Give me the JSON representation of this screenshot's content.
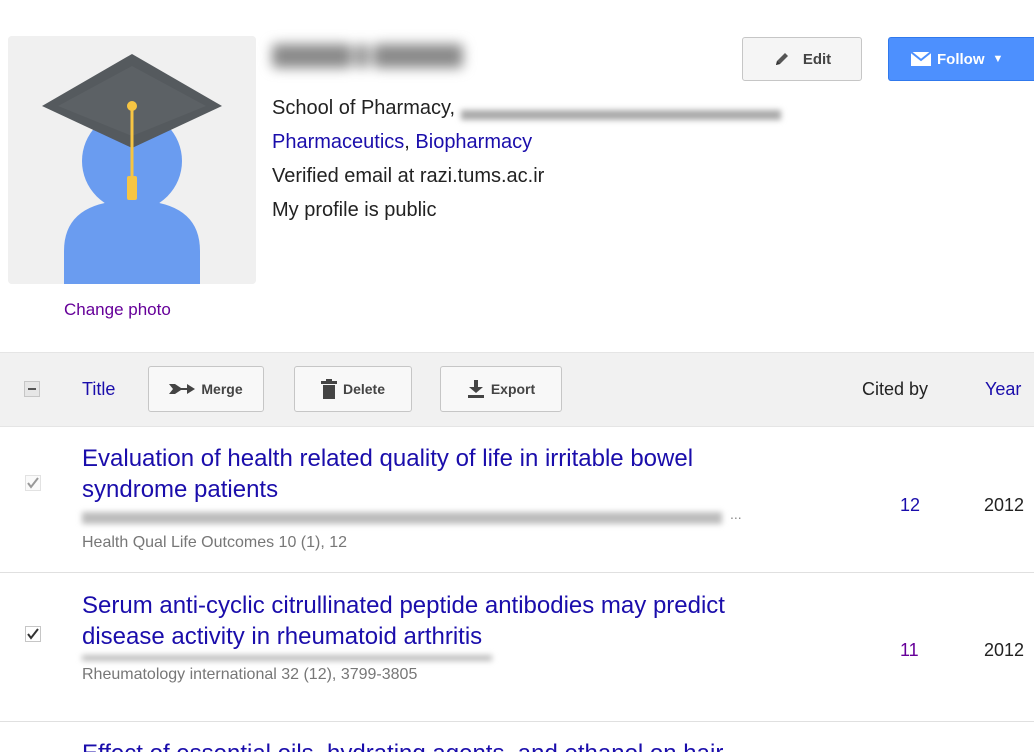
{
  "profile": {
    "change_photo": "Change photo",
    "affiliation": "School of Pharmacy,",
    "interests": [
      "Pharmaceutics",
      "Biopharmacy"
    ],
    "interest_separator": ", ",
    "verified_email": "Verified email at razi.tums.ac.ir",
    "visibility": "My profile is public"
  },
  "actions": {
    "edit_label": "Edit",
    "follow_label": "Follow",
    "follow_color": "#4d90fe"
  },
  "toolbar": {
    "title_header": "Title",
    "merge_label": "Merge",
    "delete_label": "Delete",
    "export_label": "Export",
    "cited_by_header": "Cited by",
    "year_header": "Year"
  },
  "articles": [
    {
      "title": "Evaluation of health related quality of life in irritable bowel syndrome patients",
      "venue": "Health Qual Life Outcomes 10 (1), 12",
      "cited_by": "12",
      "year": "2012",
      "checked": true
    },
    {
      "title": "Serum anti-cyclic citrullinated peptide antibodies may predict disease activity in rheumatoid arthritis",
      "venue": "Rheumatology international 32 (12), 3799-3805",
      "cited_by": "11",
      "year": "2012",
      "checked": true
    },
    {
      "title": "Effect of essential oils, hydrating agents, and ethanol on hair",
      "venue": "",
      "cited_by": "",
      "year": "",
      "checked": false
    }
  ],
  "icons": {
    "avatar": "graduate-avatar-icon",
    "edit": "pencil-icon",
    "follow": "envelope-icon",
    "merge": "merge-arrow-icon",
    "delete": "trash-icon",
    "export": "download-icon"
  }
}
